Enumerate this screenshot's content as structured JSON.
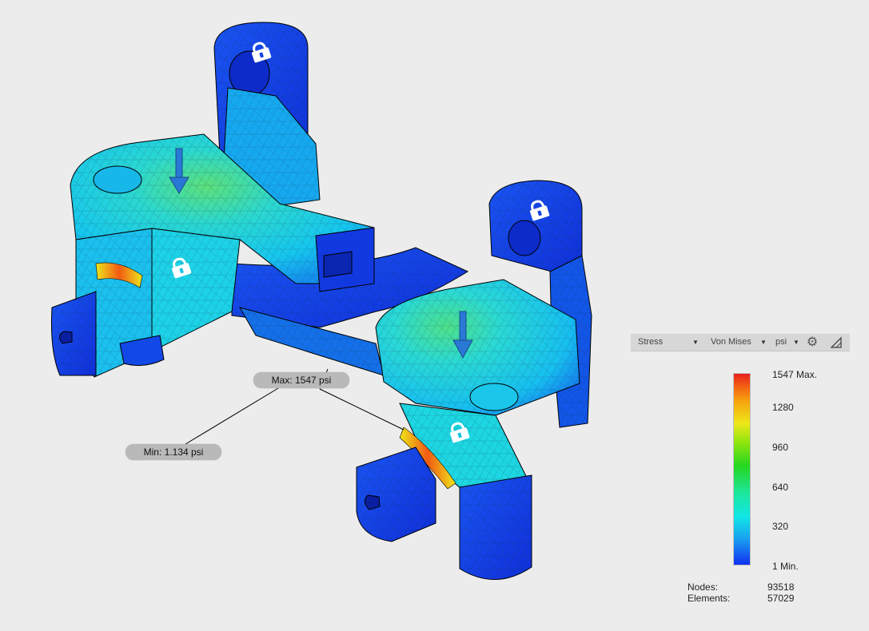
{
  "callouts": {
    "max": "Max: 1547 psi",
    "min": "Min: 1.134 psi"
  },
  "toolbar": {
    "result_type": "Stress",
    "stress_component": "Von Mises",
    "unit": "psi"
  },
  "legend": {
    "labels": [
      "1547 Max.",
      "1280",
      "960",
      "640",
      "320",
      "1 Min."
    ],
    "colors": [
      "#e8201c",
      "#f7a10e",
      "#eee71a",
      "#26d61e",
      "#10e6e6",
      "#1030f0"
    ]
  },
  "mesh_info": {
    "nodes_label": "Nodes:",
    "nodes_value": "93518",
    "elements_label": "Elements:",
    "elements_value": "57029"
  },
  "icons": {
    "constraint": "lock-icon",
    "load": "down-arrow-icon",
    "settings": "gear-icon",
    "expand": "corner-triangle-icon"
  },
  "colors": {
    "background": "#ececec",
    "low_stress": "#1030f0",
    "mid_stress": "#10e6e6",
    "high_stress": "#e8201c"
  }
}
